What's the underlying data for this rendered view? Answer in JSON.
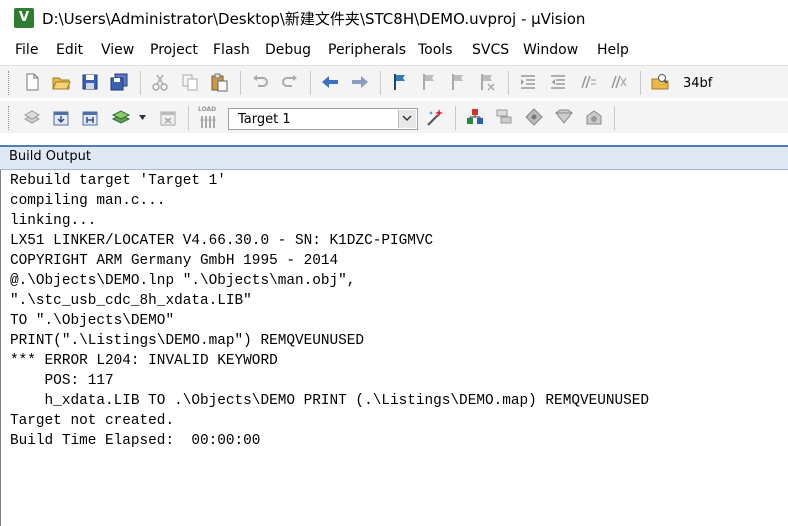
{
  "window": {
    "title": "D:\\Users\\Administrator\\Desktop\\新建文件夹\\STC8H\\DEMO.uvproj - µVision"
  },
  "menu": [
    "File",
    "Edit",
    "View",
    "Project",
    "Flash",
    "Debug",
    "Peripherals",
    "Tools",
    "SVCS",
    "Window",
    "Help"
  ],
  "toolbar1": {
    "icons": [
      "new-file-icon",
      "open-folder-icon",
      "save-icon",
      "save-all-icon",
      "cut-icon",
      "copy-icon",
      "paste-icon",
      "undo-icon",
      "redo-icon",
      "navigate-back-icon",
      "navigate-forward-icon",
      "bookmark-icon",
      "prev-bookmark-icon",
      "next-bookmark-icon",
      "clear-bookmarks-icon",
      "indent-icon",
      "unindent-icon",
      "comment-icon",
      "uncomment-icon",
      "find-in-files-icon"
    ],
    "find_text": "34bf"
  },
  "toolbar2": {
    "icons": [
      "translate-icon",
      "build-icon",
      "rebuild-icon",
      "batch-build-icon",
      "stop-build-icon",
      "download-icon",
      "target-options-icon",
      "manage-project-icon",
      "select-packs-icon",
      "manage-environment-icon",
      "pack-installer-icon"
    ],
    "download_label": "LOAD",
    "target": "Target 1"
  },
  "build_output": {
    "title": "Build Output",
    "lines": [
      "Rebuild target 'Target 1'",
      "compiling man.c...",
      "linking...",
      "LX51 LINKER/LOCATER V4.66.30.0 - SN: K1DZC-PIGMVC",
      "COPYRIGHT ARM Germany GmbH 1995 - 2014",
      "@.\\Objects\\DEMO.lnp \".\\Objects\\man.obj\",",
      "\".\\stc_usb_cdc_8h_xdata.LIB\"",
      "TO \".\\Objects\\DEMO\"",
      "PRINT(\".\\Listings\\DEMO.map\") REMQVEUNUSED",
      "*** ERROR L204: INVALID KEYWORD",
      "    POS: 117",
      "    h_xdata.LIB TO .\\Objects\\DEMO PRINT (.\\Listings\\DEMO.map) REMQVEUNUSED",
      "Target not created.",
      "Build Time Elapsed:  00:00:00"
    ]
  },
  "colors": {
    "panel_header_bg": "#dfe8f5",
    "panel_header_border": "#4f7cba",
    "toolbar_bg": "#f4f4f4",
    "app_icon": "#2e7d32"
  }
}
